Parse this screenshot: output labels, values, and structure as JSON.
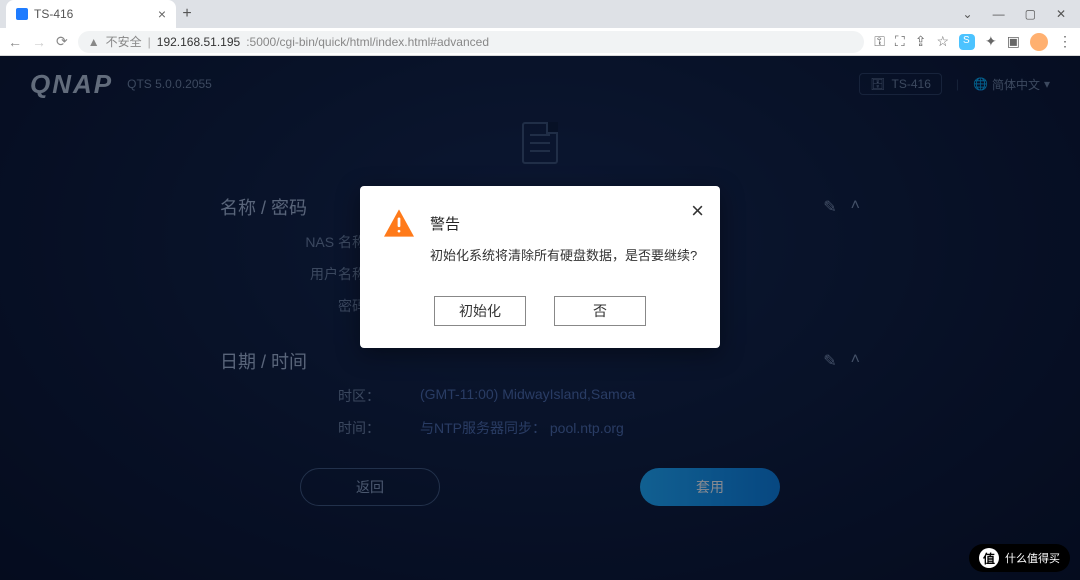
{
  "browser": {
    "tab_title": "TS-416",
    "insecure_label": "不安全",
    "url_host": "192.168.51.195",
    "url_port_path": ":5000/cgi-bin/quick/html/index.html#advanced",
    "nav": {
      "back": "←",
      "forward": "→",
      "reload": "⟳"
    },
    "win": {
      "min": "—",
      "max": "▢",
      "close": "✕",
      "drop": "⌄"
    },
    "icons": {
      "key": "⚿",
      "ext": "⛶",
      "share": "⇪",
      "star": "☆",
      "puzzle": "✦",
      "card": "▣",
      "menu": "⋮"
    }
  },
  "header": {
    "brand": "QNAP",
    "version": "QTS 5.0.0.2055",
    "device": "TS-416",
    "language": "简体中文",
    "lang_caret": "▾"
  },
  "sections": {
    "name_pwd": {
      "title": "名称 / 密码",
      "fields": {
        "nas_label": "NAS 名称：",
        "nas_value": "",
        "user_label": "用户名称：",
        "user_value": "",
        "pwd_label": "密码：",
        "pwd_value": "••••••"
      }
    },
    "date_time": {
      "title": "日期 / 时间",
      "fields": {
        "tz_label": "时区：",
        "tz_value": "(GMT-11:00) MidwayIsland,Samoa",
        "time_label": "时间：",
        "time_value": "与NTP服务器同步： pool.ntp.org"
      }
    },
    "actions": {
      "edit": "✎",
      "collapse": "˄"
    }
  },
  "buttons": {
    "back": "返回",
    "apply": "套用"
  },
  "modal": {
    "title": "警告",
    "message": "初始化系统将清除所有硬盘数据，是否要继续?",
    "init": "初始化",
    "no": "否"
  },
  "watermark": {
    "text": "什么值得买",
    "logo": "值"
  }
}
